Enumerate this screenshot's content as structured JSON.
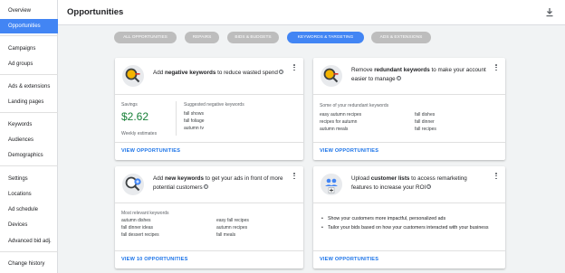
{
  "sidebar": {
    "items": [
      {
        "label": "Overview"
      },
      {
        "label": "Opportunities"
      },
      {
        "label": "Campaigns"
      },
      {
        "label": "Ad groups"
      },
      {
        "label": "Ads & extensions"
      },
      {
        "label": "Landing pages"
      },
      {
        "label": "Keywords"
      },
      {
        "label": "Audiences"
      },
      {
        "label": "Demographics"
      },
      {
        "label": "Settings"
      },
      {
        "label": "Locations"
      },
      {
        "label": "Ad schedule"
      },
      {
        "label": "Devices"
      },
      {
        "label": "Advanced bid adj."
      },
      {
        "label": "Change history"
      }
    ],
    "active_index": 1
  },
  "header": {
    "title": "Opportunities",
    "download_icon": "download-icon"
  },
  "chips": [
    {
      "label": "ALL OPPORTUNITIES"
    },
    {
      "label": "REPAIRS"
    },
    {
      "label": "BIDS & BUDGETS"
    },
    {
      "label": "KEYWORDS & TARGETING",
      "active": true
    },
    {
      "label": "ADS & EXTENSIONS"
    }
  ],
  "colors": {
    "accent": "#4285f4",
    "green": "#188038",
    "link": "#1a73e8",
    "icon_orange": "#f4b400"
  },
  "cards": {
    "negative": {
      "title_pre": "Add ",
      "title_bold": "negative keywords",
      "title_post": " to reduce wasted spend",
      "savings_label": "Savings",
      "savings_value": "$2.62",
      "savings_note": "Weekly estimates",
      "suggested_label": "Suggested negative keywords",
      "suggested": [
        "fall shows",
        "fall foliage",
        "autumn tv"
      ],
      "link": "VIEW OPPORTUNITIES"
    },
    "redundant": {
      "title_pre": "Remove ",
      "title_bold": "redundant keywords",
      "title_post": " to make your account easier to manage",
      "list_label": "Some of your redundant keywords",
      "col1": [
        "easy autumn recipes",
        "recipes for autumn",
        "autumn meals"
      ],
      "col2": [
        "fall dishes",
        "fall dinner",
        "fall recipes"
      ],
      "link": "VIEW OPPORTUNITIES"
    },
    "newkw": {
      "title_pre": "Add ",
      "title_bold": "new keywords",
      "title_post": " to get your ads in front of more potential customers",
      "list_label": "Most relevant keywords",
      "col1": [
        "autumn dishes",
        "fall dinner ideas",
        "fall dessert recipes"
      ],
      "col2": [
        "easy fall recipes",
        "autumn recipes",
        "fall meals"
      ],
      "link": "VIEW 10 OPPORTUNITIES"
    },
    "customer": {
      "title_pre": "Upload ",
      "title_bold": "customer lists",
      "title_post": " to access remarketing features to increase your ROI",
      "bullets": [
        "Show your customers more impactful, personalized ads",
        "Tailor your bids based on how your customers interacted with your business"
      ],
      "link": "VIEW OPPORTUNITIES"
    }
  }
}
